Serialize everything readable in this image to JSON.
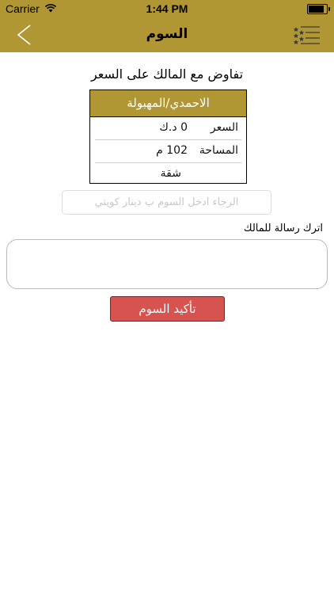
{
  "status_bar": {
    "carrier": "Carrier",
    "time": "1:44 PM",
    "battery_level_percent": 95
  },
  "nav_bar": {
    "title": "السوم",
    "back_icon": "chevron-left-icon",
    "menu_icon": "starred-list-menu-icon",
    "tint_color": "#b09734"
  },
  "main": {
    "heading": "تفاوض مع المالك على السعر",
    "property_card": {
      "title": "الاحمدي/المهبولة",
      "rows": [
        {
          "label": "السعر",
          "value": "0 د.ك"
        },
        {
          "label": "المساحة",
          "value": "102 م"
        }
      ],
      "type": "شقة"
    },
    "offer_input": {
      "value": "",
      "placeholder": "الرجاء ادخل السوم ب دينار كويتي"
    },
    "message": {
      "label": "اترك رسالة للمالك",
      "value": ""
    },
    "confirm_button": {
      "label": "تأكيد السوم",
      "color": "#d7534f"
    }
  }
}
